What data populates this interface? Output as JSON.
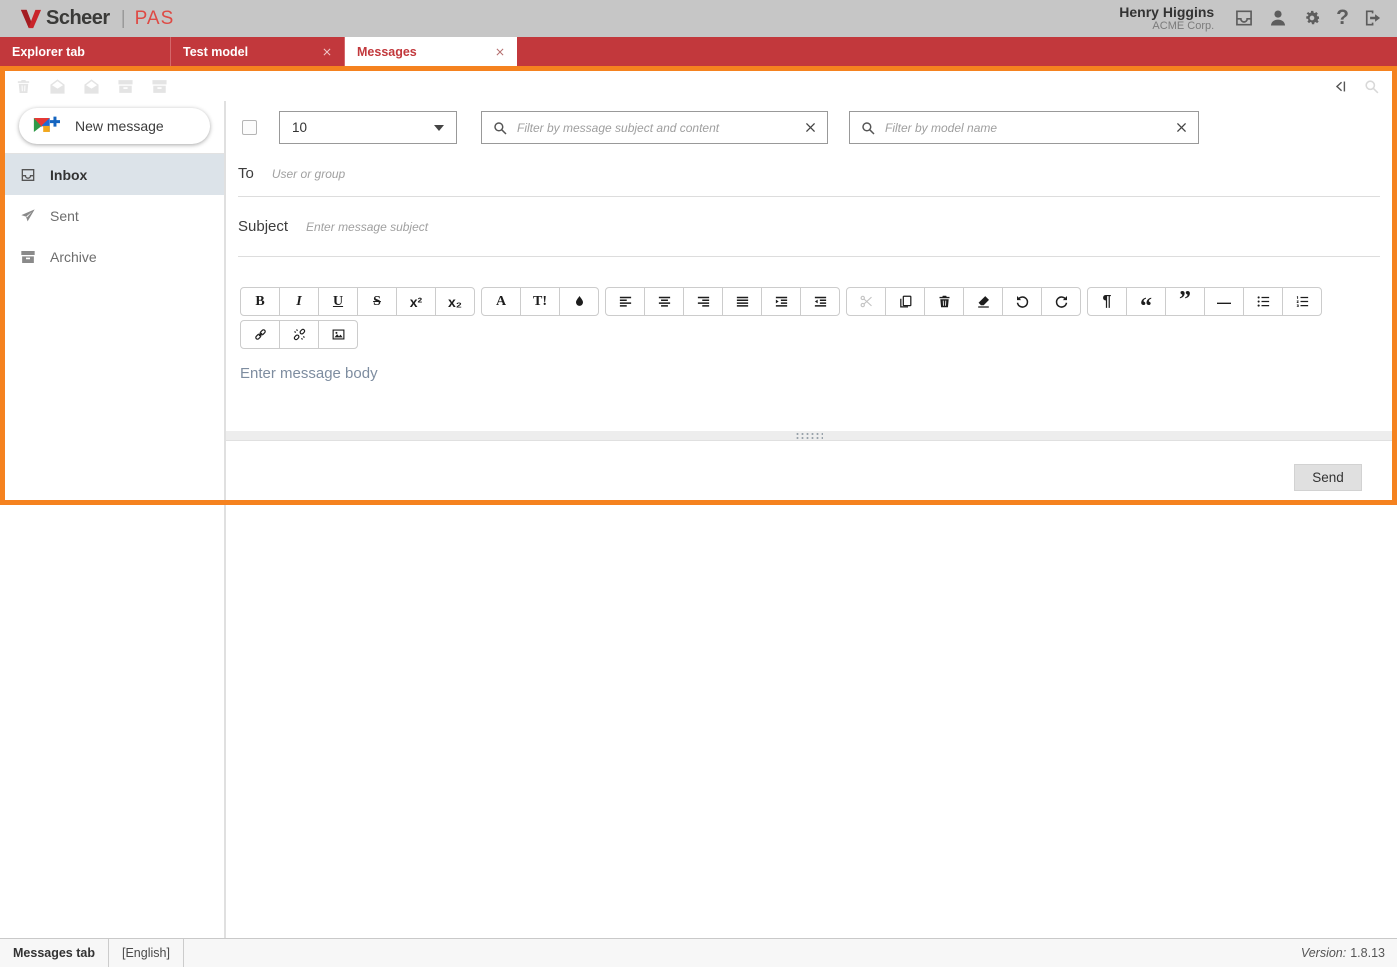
{
  "header": {
    "brand": "Scheer",
    "brand_divider": "|",
    "product": "PAS",
    "user_name": "Henry Higgins",
    "user_org": "ACME Corp.",
    "help_glyph": "?"
  },
  "tabs": [
    {
      "label": "Explorer tab",
      "active": false,
      "closable": false
    },
    {
      "label": "Test model",
      "active": false,
      "closable": true
    },
    {
      "label": "Messages",
      "active": true,
      "closable": true
    }
  ],
  "message_toolbar": {
    "items": [
      {
        "name": "delete-message",
        "icon": "trash",
        "disabled": true
      },
      {
        "name": "mark-read",
        "icon": "envelope-open",
        "disabled": true
      },
      {
        "name": "mark-unread",
        "icon": "envelope-open",
        "disabled": true
      },
      {
        "name": "archive-message",
        "icon": "box",
        "disabled": true
      },
      {
        "name": "unarchive-message",
        "icon": "box",
        "disabled": true
      }
    ]
  },
  "sidebar": {
    "new_message_label": "New message",
    "items": [
      {
        "label": "Inbox",
        "icon": "tray",
        "selected": true
      },
      {
        "label": "Sent",
        "icon": "plane",
        "selected": false
      },
      {
        "label": "Archive",
        "icon": "box",
        "selected": false
      }
    ]
  },
  "filters": {
    "page_size": "10",
    "subject_placeholder": "Filter by message subject and content",
    "model_placeholder": "Filter by model name"
  },
  "compose": {
    "to_label": "To",
    "to_placeholder": "User or group",
    "subject_label": "Subject",
    "subject_placeholder": "Enter message subject",
    "body_placeholder": "Enter message body",
    "send_label": "Send"
  },
  "editor_toolbar": {
    "rows": [
      {
        "groups": [
          {
            "buttons": [
              {
                "name": "bold"
              },
              {
                "name": "italic"
              },
              {
                "name": "underline"
              },
              {
                "name": "strikethrough"
              },
              {
                "name": "superscript"
              },
              {
                "name": "subscript"
              }
            ]
          },
          {
            "buttons": [
              {
                "name": "font-family"
              },
              {
                "name": "font-size"
              },
              {
                "name": "text-color"
              }
            ]
          },
          {
            "buttons": [
              {
                "name": "align-left"
              },
              {
                "name": "align-center"
              },
              {
                "name": "align-right"
              },
              {
                "name": "justify"
              },
              {
                "name": "indent"
              },
              {
                "name": "outdent"
              }
            ]
          },
          {
            "buttons": [
              {
                "name": "cut",
                "disabled": true
              },
              {
                "name": "copy"
              },
              {
                "name": "delete"
              },
              {
                "name": "remove-format"
              },
              {
                "name": "undo"
              },
              {
                "name": "redo"
              }
            ]
          },
          {
            "buttons": [
              {
                "name": "paragraph"
              },
              {
                "name": "quote-open"
              },
              {
                "name": "quote-close"
              },
              {
                "name": "horizontal-rule"
              },
              {
                "name": "unordered-list"
              },
              {
                "name": "ordered-list"
              }
            ]
          }
        ]
      },
      {
        "groups": [
          {
            "buttons": [
              {
                "name": "link"
              },
              {
                "name": "unlink"
              },
              {
                "name": "image"
              }
            ]
          }
        ]
      }
    ]
  },
  "statusbar": {
    "tab_name": "Messages tab",
    "language": "[English]",
    "version_label": "Version:",
    "version": "1.8.13"
  },
  "colors": {
    "accent_orange": "#f5821f",
    "brand_red": "#c2383c",
    "header_gray": "#c6c6c6",
    "selected_item_bg": "#dce3e9"
  }
}
